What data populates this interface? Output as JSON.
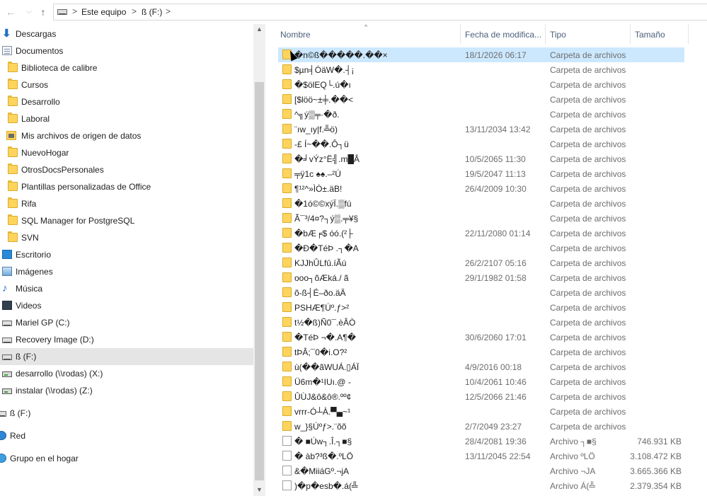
{
  "address": {
    "crumbs": [
      "Este equipo",
      "ß (F:)"
    ],
    "sep": ">",
    "back_icon": "back-arrow-icon",
    "forward_icon": "forward-arrow-icon",
    "recent_icon": "chevron-down-icon",
    "up_icon": "up-arrow-icon"
  },
  "sidebar": {
    "items": [
      {
        "label": "Descargas",
        "icon": "download-icon"
      },
      {
        "label": "Documentos",
        "icon": "documents-icon"
      },
      {
        "label": "Biblioteca de calibre",
        "icon": "folder-icon"
      },
      {
        "label": "Cursos",
        "icon": "folder-icon"
      },
      {
        "label": "Desarrollo",
        "icon": "folder-icon"
      },
      {
        "label": "Laboral",
        "icon": "folder-icon"
      },
      {
        "label": "Mis archivos de origen de datos",
        "icon": "data-sources-folder-icon"
      },
      {
        "label": "NuevoHogar",
        "icon": "folder-icon"
      },
      {
        "label": "OtrosDocsPersonales",
        "icon": "folder-icon"
      },
      {
        "label": "Plantillas personalizadas de Office",
        "icon": "folder-icon"
      },
      {
        "label": "Rifa",
        "icon": "folder-icon"
      },
      {
        "label": "SQL Manager for PostgreSQL",
        "icon": "folder-icon"
      },
      {
        "label": "SVN",
        "icon": "folder-icon"
      },
      {
        "label": "Escritorio",
        "icon": "desktop-icon"
      },
      {
        "label": "Imágenes",
        "icon": "pictures-icon"
      },
      {
        "label": "Música",
        "icon": "music-icon"
      },
      {
        "label": "Videos",
        "icon": "videos-icon"
      },
      {
        "label": "Mariel GP (C:)",
        "icon": "drive-icon"
      },
      {
        "label": "Recovery Image (D:)",
        "icon": "drive-icon"
      },
      {
        "label": "ß (F:)",
        "icon": "drive-icon"
      },
      {
        "label": "desarrollo (\\\\rodas) (X:)",
        "icon": "network-drive-icon"
      },
      {
        "label": "instalar (\\\\rodas) (Z:)",
        "icon": "network-drive-icon"
      },
      {
        "label": "ß (F:)",
        "icon": "drive-icon"
      },
      {
        "label": "Red",
        "icon": "network-icon"
      },
      {
        "label": "Grupo en el hogar",
        "icon": "homegroup-icon"
      }
    ]
  },
  "columns": {
    "name": "Nombre",
    "date": "Fecha de modifica...",
    "type": "Tipo",
    "size": "Tamaño"
  },
  "files": [
    {
      "name": "�n©ß�����.��×",
      "date": "18/1/2026 06:17",
      "type": "Carpeta de archivos",
      "size": "",
      "kind": "folder"
    },
    {
      "name": "$µn╡ÓäW�.┤¡",
      "date": "",
      "type": "Carpeta de archivos",
      "size": "",
      "kind": "folder"
    },
    {
      "name": "�$ölEQ└.ú�ı",
      "date": "",
      "type": "Carpeta de archivos",
      "size": "",
      "kind": "folder"
    },
    {
      "name": "[$löö~±╪.��<",
      "date": "",
      "type": "Carpeta de archivos",
      "size": "",
      "kind": "folder"
    },
    {
      "name": "^╗ý▒╤·�ð.",
      "date": "",
      "type": "Carpeta de archivos",
      "size": "",
      "kind": "folder"
    },
    {
      "name": "¨ıw_ıy|f.╩ö)",
      "date": "13/11/2034 13:42",
      "type": "Carpeta de archivos",
      "size": "",
      "kind": "folder"
    },
    {
      "name": "-£ Í~��.Ô┐ü",
      "date": "",
      "type": "Carpeta de archivos",
      "size": "",
      "kind": "folder"
    },
    {
      "name": "�╛vÝz°Ë╣.m█Â",
      "date": "10/5/2065 11:30",
      "type": "Carpeta de archivos",
      "size": "",
      "kind": "folder"
    },
    {
      "name": "╤ÿ1c ♠♠.–²Ú",
      "date": "19/5/2047 11:13",
      "type": "Carpeta de archivos",
      "size": "",
      "kind": "folder"
    },
    {
      "name": "¶¹²^»ÌÒ±.äB!",
      "date": "26/4/2009 10:30",
      "type": "Carpeta de archivos",
      "size": "",
      "kind": "folder"
    },
    {
      "name": "�1ó©©xýÏ.▒fú",
      "date": "",
      "type": "Carpeta de archivos",
      "size": "",
      "kind": "folder"
    },
    {
      "name": "Ã¯³/4¤?┐ý▒.╤¥§",
      "date": "",
      "type": "Carpeta de archivos",
      "size": "",
      "kind": "folder"
    },
    {
      "name": "�bÆ╒$ óó.(²├",
      "date": "22/11/2080 01:14",
      "type": "Carpeta de archivos",
      "size": "",
      "kind": "folder"
    },
    {
      "name": "�Ð�TéÞ .┐�A",
      "date": "",
      "type": "Carpeta de archivos",
      "size": "",
      "kind": "folder"
    },
    {
      "name": "KJJhÛLfû.íÃú",
      "date": "26/2/2107 05:16",
      "type": "Carpeta de archivos",
      "size": "",
      "kind": "folder"
    },
    {
      "name": "ooo┐õÆká./ ã",
      "date": "29/1/1982 01:58",
      "type": "Carpeta de archivos",
      "size": "",
      "kind": "folder"
    },
    {
      "name": "õ-ß┤É–ðo.äÄ",
      "date": "",
      "type": "Carpeta de archivos",
      "size": "",
      "kind": "folder"
    },
    {
      "name": "PSHÆ¶Úº.ƒ>²",
      "date": "",
      "type": "Carpeta de archivos",
      "size": "",
      "kind": "folder"
    },
    {
      "name": "t½�ß)Ñ0¯.èÂÒ",
      "date": "",
      "type": "Carpeta de archivos",
      "size": "",
      "kind": "folder"
    },
    {
      "name": "�TéÞ ¬�.A¶�",
      "date": "30/6/2060 17:01",
      "type": "Carpeta de archivos",
      "size": "",
      "kind": "folder"
    },
    {
      "name": "tÞÂ;¯0�i.O?²",
      "date": "",
      "type": "Carpeta de archivos",
      "size": "",
      "kind": "folder"
    },
    {
      "name": "ù(��ãWUÁ.▯ÁÏ",
      "date": "4/9/2016 00:18",
      "type": "Carpeta de archivos",
      "size": "",
      "kind": "folder"
    },
    {
      "name": "Ü6m�¹IUı.@ -",
      "date": "10/4/2061 10:46",
      "type": "Carpeta de archivos",
      "size": "",
      "kind": "folder"
    },
    {
      "name": "ÛÙJ&ô&ô®.ºº¢",
      "date": "12/5/2066 21:46",
      "type": "Carpeta de archivos",
      "size": "",
      "kind": "folder"
    },
    {
      "name": "vrrr-Ó┴À.▀▄~¹",
      "date": "",
      "type": "Carpeta de archivos",
      "size": "",
      "kind": "folder"
    },
    {
      "name": "w_}§Úºƒ>.¨õõ",
      "date": "2/7/2049 23:27",
      "type": "Carpeta de archivos",
      "size": "",
      "kind": "folder"
    },
    {
      "name": "� ■Úw┐.Î.┐■§",
      "date": "28/4/2081 19:36",
      "type": "Archivo ┐■§",
      "size": "746.931 KB",
      "kind": "file"
    },
    {
      "name": "� àb?³ß�.ºLÖ",
      "date": "13/11/2045 22:54",
      "type": "Archivo ºLÖ",
      "size": "3.108.472 KB",
      "kind": "file"
    },
    {
      "name": "&�MiiáGº.¬jA",
      "date": "",
      "type": "Archivo ¬JA",
      "size": "3.665.366 KB",
      "kind": "file"
    },
    {
      "name": ")�p�esb�.á(╩",
      "date": "",
      "type": "Archivo Á(╩",
      "size": "2.379.354 KB",
      "kind": "file"
    }
  ]
}
